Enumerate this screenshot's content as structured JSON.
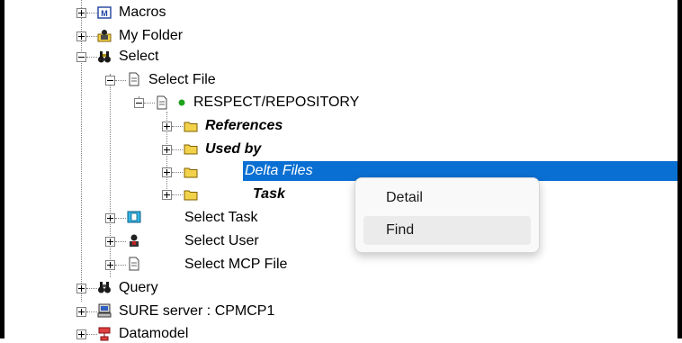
{
  "tree": {
    "items": [
      {
        "label": "Macros",
        "icon": "macro-icon",
        "expander": "plus"
      },
      {
        "label": "My Folder",
        "icon": "user-folder-icon",
        "expander": "plus"
      },
      {
        "label": "Select",
        "icon": "binoculars-icon",
        "expander": "minus"
      },
      {
        "label": "Select File",
        "icon": "document-icon",
        "expander": "minus"
      },
      {
        "label": "RESPECT/REPOSITORY",
        "icon": "document-icon",
        "status_color": "#1fa31f",
        "expander": "minus"
      },
      {
        "label": "References",
        "icon": "folder-icon",
        "expander": "plus"
      },
      {
        "label": "Used by",
        "icon": "folder-icon",
        "expander": "plus"
      },
      {
        "label": "Delta Files",
        "icon": "folder-icon",
        "expander": "plus",
        "selected": true
      },
      {
        "label": "Task",
        "icon": "folder-icon",
        "expander": "plus"
      },
      {
        "label": "Select Task",
        "icon": "task-icon",
        "expander": "plus"
      },
      {
        "label": "Select User",
        "icon": "user-icon",
        "expander": "plus"
      },
      {
        "label": "Select MCP File",
        "icon": "document-icon",
        "expander": "plus"
      },
      {
        "label": "Query",
        "icon": "binoculars-icon",
        "expander": "plus"
      },
      {
        "label": "SURE server : CPMCP1",
        "icon": "server-icon",
        "expander": "plus"
      },
      {
        "label": "Datamodel",
        "icon": "datamodel-icon",
        "expander": "plus"
      }
    ]
  },
  "context_menu": {
    "items": [
      {
        "label": "Detail"
      },
      {
        "label": "Find",
        "hovered": true
      }
    ]
  },
  "colors": {
    "selection": "#0a6fd2",
    "folder": "#f2d24b",
    "status_dot": "#1fa31f",
    "menu_bg": "#f9f9f9",
    "menu_hover": "#ebebeb"
  }
}
